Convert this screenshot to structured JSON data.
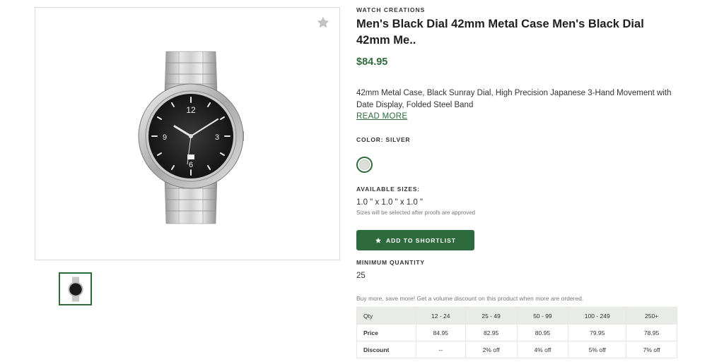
{
  "product": {
    "brand": "WATCH CREATIONS",
    "title": "Men's Black Dial 42mm Metal Case Men's Black Dial 42mm Me..",
    "price": "$84.95",
    "description": "42mm Metal Case, Black Sunray Dial, High Precision Japanese 3-Hand Movement with Date Display, Folded Steel Band",
    "read_more": "READ MORE",
    "color_label": "COLOR: SILVER",
    "swatch_color": "#dcdfd9",
    "sizes_label": "AVAILABLE SIZES:",
    "size_value": "1.0 \" x 1.0 \" x 1.0 \"",
    "size_note": "Sizes will be selected after proofs are approved",
    "add_button": "ADD TO SHORTLIST",
    "min_qty_label": "MINIMUM QUANTITY",
    "min_qty_value": "25",
    "promo": "Buy more, save more! Get a volume discount on this product when more are ordered."
  },
  "colors": {
    "accent": "#2e6b3c",
    "table_header_bg": "#e8ebe6"
  },
  "icons": {
    "favorite": "star-icon",
    "button": "star-icon"
  },
  "pricing": {
    "header": [
      "Qty",
      "12 - 24",
      "25 - 49",
      "50 - 99",
      "100 - 249",
      "250+"
    ],
    "price": [
      "Price",
      "84.95",
      "82.95",
      "80.95",
      "79.95",
      "78.95"
    ],
    "discount": [
      "Discount",
      "--",
      "2% off",
      "4% off",
      "5% off",
      "7% off"
    ]
  }
}
